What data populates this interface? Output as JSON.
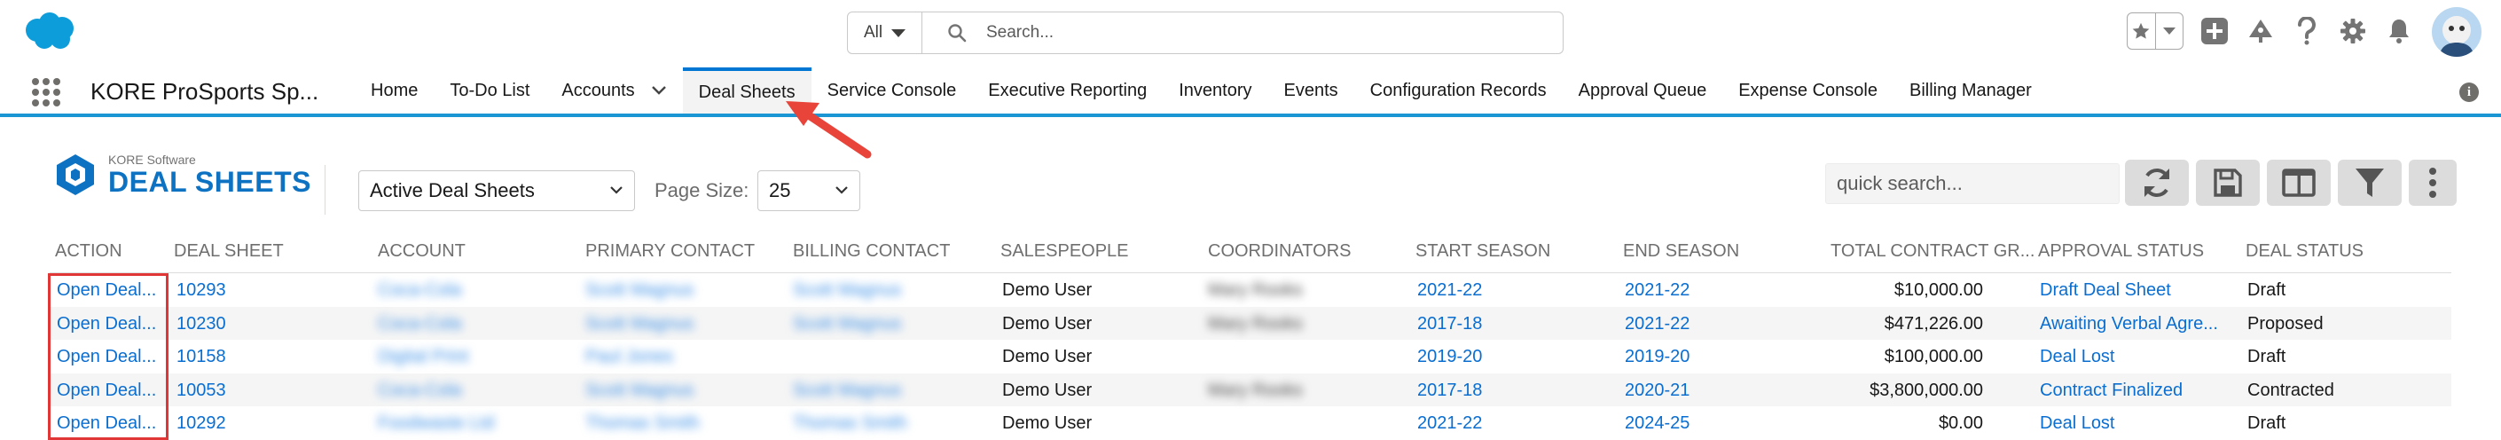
{
  "header": {
    "search_scope": "All",
    "search_placeholder": "Search...",
    "icons": [
      "favorites-star-icon",
      "favorites-list-icon",
      "add-icon",
      "trailhead-icon",
      "help-icon",
      "setup-gear-icon",
      "notification-bell-icon",
      "user-avatar"
    ]
  },
  "nav": {
    "app_name": "KORE ProSports Sp...",
    "items": [
      {
        "label": "Home"
      },
      {
        "label": "To-Do List"
      },
      {
        "label": "Accounts"
      },
      {
        "label": "Deal Sheets"
      },
      {
        "label": "Service Console"
      },
      {
        "label": "Executive Reporting"
      },
      {
        "label": "Inventory"
      },
      {
        "label": "Events"
      },
      {
        "label": "Configuration Records"
      },
      {
        "label": "Approval Queue"
      },
      {
        "label": "Expense Console"
      },
      {
        "label": "Billing Manager"
      }
    ],
    "active": "Deal Sheets"
  },
  "panel": {
    "brand_small": "KORE Software",
    "brand_title": "DEAL SHEETS",
    "view_select": "Active Deal Sheets",
    "page_size_label": "Page Size:",
    "page_size_value": "25",
    "quick_search_placeholder": "quick search...",
    "tools": [
      "refresh-icon",
      "save-icon",
      "columns-icon",
      "filter-icon",
      "more-icon"
    ]
  },
  "table": {
    "columns": [
      "ACTION",
      "DEAL SHEET",
      "ACCOUNT",
      "PRIMARY CONTACT",
      "BILLING CONTACT",
      "SALESPEOPLE",
      "COORDINATORS",
      "START SEASON",
      "END SEASON",
      "TOTAL CONTRACT GR...",
      "APPROVAL STATUS",
      "DEAL STATUS"
    ],
    "rows": [
      {
        "action": "Open Deal...",
        "deal_sheet": "10293",
        "account": "Coca-Cola",
        "primary_contact": "Scott Magnus",
        "billing_contact": "Scott Magnus",
        "salespeople": "Demo User",
        "coordinators": "Mary Rooks",
        "start_season": "2021-22",
        "end_season": "2021-22",
        "total": "$10,000.00",
        "approval_status": "Draft Deal Sheet",
        "deal_status": "Draft"
      },
      {
        "action": "Open Deal...",
        "deal_sheet": "10230",
        "account": "Coca-Cola",
        "primary_contact": "Scott Magnus",
        "billing_contact": "Scott Magnus",
        "salespeople": "Demo User",
        "coordinators": "Mary Rooks",
        "start_season": "2017-18",
        "end_season": "2021-22",
        "total": "$471,226.00",
        "approval_status": "Awaiting Verbal Agre...",
        "deal_status": "Proposed"
      },
      {
        "action": "Open Deal...",
        "deal_sheet": "10158",
        "account": "Digital Print",
        "primary_contact": "Paul Jones",
        "billing_contact": "",
        "salespeople": "Demo User",
        "coordinators": "",
        "start_season": "2019-20",
        "end_season": "2019-20",
        "total": "$100,000.00",
        "approval_status": "Deal Lost",
        "deal_status": "Draft"
      },
      {
        "action": "Open Deal...",
        "deal_sheet": "10053",
        "account": "Coca-Cola",
        "primary_contact": "Scott Magnus",
        "billing_contact": "Scott Magnus",
        "salespeople": "Demo User",
        "coordinators": "Mary Rooks",
        "start_season": "2017-18",
        "end_season": "2020-21",
        "total": "$3,800,000.00",
        "approval_status": "Contract Finalized",
        "deal_status": "Contracted"
      },
      {
        "action": "Open Deal...",
        "deal_sheet": "10292",
        "account": "Foodwaste Ltd",
        "primary_contact": "Thomas Smith",
        "billing_contact": "Thomas Smith",
        "salespeople": "Demo User",
        "coordinators": "",
        "start_season": "2021-22",
        "end_season": "2024-25",
        "total": "$0.00",
        "approval_status": "Deal Lost",
        "deal_status": "Draft"
      }
    ]
  },
  "colors": {
    "accent": "#0176d3",
    "link": "#0a6ed1",
    "nav_underline": "#1b96d4",
    "highlight": "#e03636"
  }
}
